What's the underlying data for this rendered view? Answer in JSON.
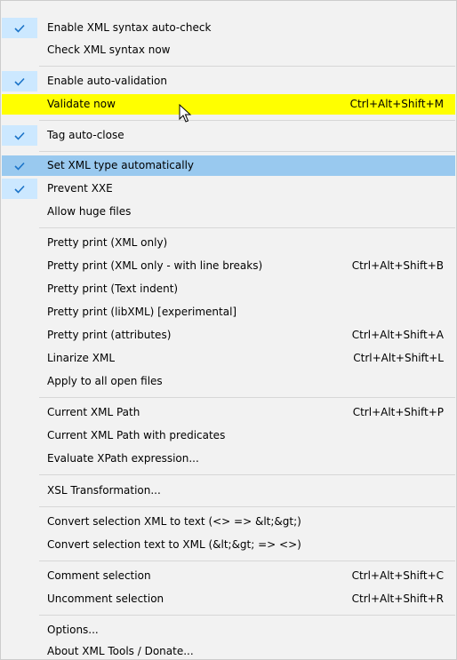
{
  "menu": {
    "items": [
      {
        "label": "Enable XML syntax auto-check",
        "shortcut": "",
        "checked": true
      },
      {
        "label": "Check XML syntax now",
        "shortcut": "",
        "checked": false
      },
      {
        "label": "Enable auto-validation",
        "shortcut": "",
        "checked": true
      },
      {
        "label": "Validate now",
        "shortcut": "Ctrl+Alt+Shift+M",
        "checked": false
      },
      {
        "label": "Tag auto-close",
        "shortcut": "",
        "checked": true
      },
      {
        "label": "Set XML type automatically",
        "shortcut": "",
        "checked": true
      },
      {
        "label": "Prevent XXE",
        "shortcut": "",
        "checked": true
      },
      {
        "label": "Allow huge files",
        "shortcut": "",
        "checked": false
      },
      {
        "label": "Pretty print (XML only)",
        "shortcut": "",
        "checked": false
      },
      {
        "label": "Pretty print (XML only - with line breaks)",
        "shortcut": "Ctrl+Alt+Shift+B",
        "checked": false
      },
      {
        "label": "Pretty print (Text indent)",
        "shortcut": "",
        "checked": false
      },
      {
        "label": "Pretty print (libXML) [experimental]",
        "shortcut": "",
        "checked": false
      },
      {
        "label": "Pretty print (attributes)",
        "shortcut": "Ctrl+Alt+Shift+A",
        "checked": false
      },
      {
        "label": "Linarize XML",
        "shortcut": "Ctrl+Alt+Shift+L",
        "checked": false
      },
      {
        "label": "Apply to all open files",
        "shortcut": "",
        "checked": false
      },
      {
        "label": "Current XML Path",
        "shortcut": "Ctrl+Alt+Shift+P",
        "checked": false
      },
      {
        "label": "Current XML Path with predicates",
        "shortcut": "",
        "checked": false
      },
      {
        "label": "Evaluate XPath expression...",
        "shortcut": "",
        "checked": false
      },
      {
        "label": "XSL Transformation...",
        "shortcut": "",
        "checked": false
      },
      {
        "label": "Convert selection XML to text (<> => &lt;&gt;)",
        "shortcut": "",
        "checked": false
      },
      {
        "label": "Convert selection text to XML (&lt;&gt; => <>)",
        "shortcut": "",
        "checked": false
      },
      {
        "label": "Comment selection",
        "shortcut": "Ctrl+Alt+Shift+C",
        "checked": false
      },
      {
        "label": "Uncomment selection",
        "shortcut": "Ctrl+Alt+Shift+R",
        "checked": false
      },
      {
        "label": "Options...",
        "shortcut": "",
        "checked": false
      },
      {
        "label": "About XML Tools / Donate...",
        "shortcut": "",
        "checked": false
      }
    ],
    "hovered_item": "Validate now",
    "selected_item": "Set XML type automatically"
  },
  "colors": {
    "menu_background": "#f2f2f2",
    "check_background": "#cce8ff",
    "check_mark": "#1a73c8",
    "hover_yellow": "#ffff00",
    "selected_blue": "#99c9ef",
    "separator": "#d7d7d7"
  },
  "icons": {
    "check": "check-icon",
    "cursor": "mouse-pointer-icon"
  }
}
